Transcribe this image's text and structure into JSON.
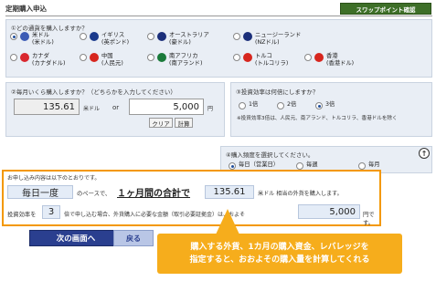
{
  "header": {
    "title": "定期購入申込",
    "swap_button": "スワップポイント確認"
  },
  "q1": {
    "question": "①どの通貨を購入しますか？",
    "currencies": [
      {
        "name": "米ドル",
        "sub": "(米ドル)",
        "selected": true,
        "flag": "flag-us-icon",
        "color": "#3b5bb5"
      },
      {
        "name": "イギリス",
        "sub": "(英ポンド)",
        "selected": false,
        "flag": "flag-uk-icon",
        "color": "#1a3a8c"
      },
      {
        "name": "オーストラリア",
        "sub": "(豪ドル)",
        "selected": false,
        "flag": "flag-au-icon",
        "color": "#1b2f7a"
      },
      {
        "name": "ニュージーランド",
        "sub": "(NZドル)",
        "selected": false,
        "flag": "flag-nz-icon",
        "color": "#1b2f7a"
      },
      {
        "name": "カナダ",
        "sub": "(カナダドル)",
        "selected": false,
        "flag": "flag-ca-icon",
        "color": "#d9272e"
      },
      {
        "name": "中国",
        "sub": "(人民元)",
        "selected": false,
        "flag": "flag-cn-icon",
        "color": "#d7261e"
      },
      {
        "name": "南アフリカ",
        "sub": "(南アランド)",
        "selected": false,
        "flag": "flag-za-icon",
        "color": "#1a7a3a"
      },
      {
        "name": "トルコ",
        "sub": "(トルコリラ)",
        "selected": false,
        "flag": "flag-tr-icon",
        "color": "#d7261e"
      },
      {
        "name": "香港",
        "sub": "(香港ドル)",
        "selected": false,
        "flag": "flag-hk-icon",
        "color": "#d7261e"
      }
    ]
  },
  "q2": {
    "question": "②毎月いくら購入しますか？（どちらかを入力してください）",
    "foreign_amount": "135.61",
    "foreign_unit": "米ドル",
    "or_label": "or",
    "yen_amount": "5,000",
    "yen_unit": "円",
    "clear_button": "クリア",
    "calc_button": "計算"
  },
  "q3": {
    "question": "③投資効率は何倍にしますか？",
    "options": [
      "1倍",
      "2倍",
      "3倍"
    ],
    "selected_index": 2,
    "note": "※投資効率3倍は、人民元、南アランド、トルコリラ、香港ドルを除く"
  },
  "q4": {
    "question": "④購入頻度を選択してください。",
    "options": [
      "毎日（営業日）",
      "毎週",
      "毎月"
    ],
    "selected_index": 0
  },
  "summary": {
    "intro": "お申し込み内容は以下のとおりです。",
    "frequency": "毎日一度",
    "base_text": "のペースで、",
    "period": "１ヶ月間の合計で",
    "amount": "135.61",
    "after_amount": "米ドル 相当の外貨を購入します。",
    "efficiency_label": "投資効率を",
    "efficiency_value": "3",
    "efficiency_text": "倍で申し込む場合、外貨購入に必要な金額（取引必要証拠金）は、およそ",
    "yen_required": "5,000",
    "yen_suffix": "円です。"
  },
  "buttons": {
    "next": "次の画面へ",
    "back": "戻る"
  },
  "callout": {
    "line1": "購入する外貨、1カ月の購入資金、レバレッジを",
    "line2": "指定すると、おおよその購入量を計算してくれる"
  }
}
